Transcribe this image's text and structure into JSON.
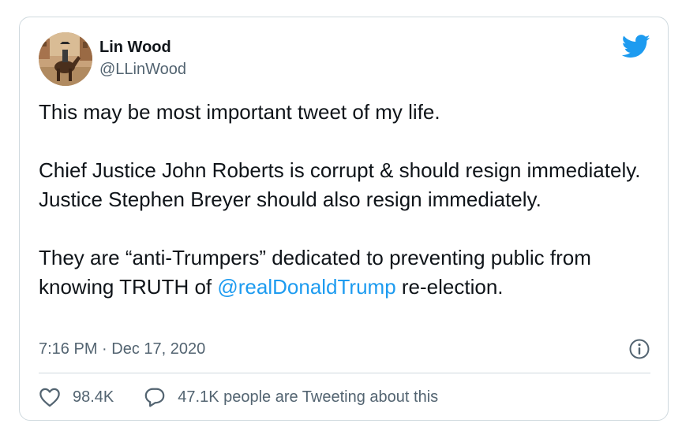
{
  "tweet": {
    "author": {
      "display_name": "Lin Wood",
      "handle": "@LLinWood",
      "avatar_icon": "avatar-horse-rider"
    },
    "logo_icon": "twitter-bird-icon",
    "body": {
      "paragraph_1": "This may be most important tweet of my life.",
      "paragraph_2": "Chief Justice John Roberts is corrupt & should resign immediately. Justice Stephen Breyer should also resign immediately.",
      "paragraph_3_before": "They are “anti-Trumpers” dedicated to preventing public from knowing TRUTH of ",
      "mention": "@realDonaldTrump",
      "paragraph_3_after": " re-election."
    },
    "timestamp": "7:16 PM · Dec 17, 2020",
    "info_icon": "info-icon",
    "actions": {
      "like_icon": "heart-icon",
      "like_count": "98.4K",
      "reply_icon": "speech-bubble-icon",
      "reply_text": "47.1K people are Tweeting about this"
    }
  },
  "colors": {
    "text_primary": "#0f1419",
    "text_secondary": "#536471",
    "link": "#1d9bf0",
    "border": "#cfd9de",
    "twitter_blue": "#1d9bf0"
  }
}
